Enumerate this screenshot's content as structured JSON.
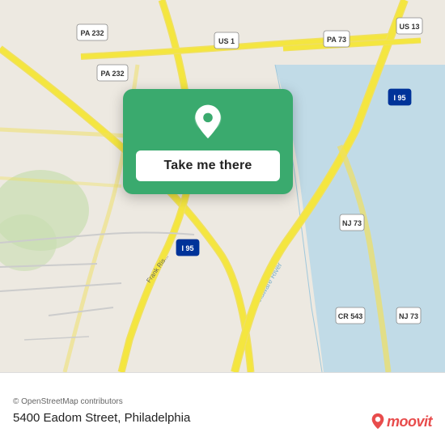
{
  "map": {
    "attribution": "© OpenStreetMap contributors",
    "address": "5400 Eadom Street, Philadelphia",
    "card": {
      "button_label": "Take me there"
    },
    "moovit_logo_text": "moovit",
    "road_labels": [
      "PA 232",
      "PA 232",
      "US 1",
      "US 13",
      "PA 73",
      "I 95",
      "I 95",
      "NJ 73",
      "CR 543",
      "NJ 73",
      "CR 543"
    ],
    "accent_color": "#3aaa6e",
    "river_color": "#aad4e8",
    "road_color": "#f5e96e",
    "bg_color": "#e8e4dc"
  }
}
